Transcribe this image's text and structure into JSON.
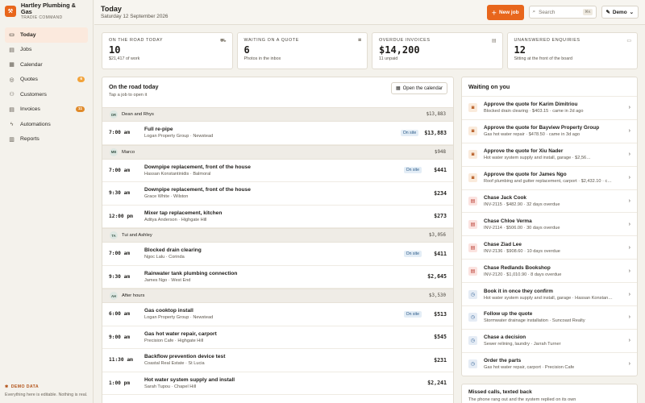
{
  "brand": {
    "logo_icon": "wrench-icon",
    "name": "Hartley Plumbing & Gas",
    "subtitle": "TRADIE COMMAND"
  },
  "nav": [
    {
      "label": "Today",
      "icon": "calendar-today-icon",
      "glyph": "▭",
      "active": true,
      "badge": null
    },
    {
      "label": "Jobs",
      "icon": "clipboard-icon",
      "glyph": "▤",
      "active": false,
      "badge": null
    },
    {
      "label": "Calendar",
      "icon": "calendar-icon",
      "glyph": "▦",
      "active": false,
      "badge": null
    },
    {
      "label": "Quotes",
      "icon": "quote-icon",
      "glyph": "◎",
      "active": false,
      "badge": "6"
    },
    {
      "label": "Customers",
      "icon": "people-icon",
      "glyph": "⚇",
      "active": false,
      "badge": null
    },
    {
      "label": "Invoices",
      "icon": "invoice-icon",
      "glyph": "▤",
      "active": false,
      "badge": "11"
    },
    {
      "label": "Automations",
      "icon": "lightning-icon",
      "glyph": "ϟ",
      "active": false,
      "badge": null
    },
    {
      "label": "Reports",
      "icon": "chart-icon",
      "glyph": "▥",
      "active": false,
      "badge": null
    }
  ],
  "demo": {
    "tag": "DEMO DATA",
    "text": "Everything here is editable. Nothing is real."
  },
  "header": {
    "title": "Today",
    "date": "Saturday 12 September 2026",
    "new_job_label": "New job",
    "search_placeholder": "Search",
    "search_shortcut": "⌘K",
    "demo_select": "Demo"
  },
  "stats": [
    {
      "label": "ON THE ROAD TODAY",
      "value": "10",
      "sub": "$21,417 of work",
      "icon": "truck-icon",
      "glyph": "⛟"
    },
    {
      "label": "WAITING ON A QUOTE",
      "value": "6",
      "sub": "Photos in the inbox",
      "icon": "camera-icon",
      "glyph": "◙"
    },
    {
      "label": "OVERDUE INVOICES",
      "value": "$14,200",
      "sub": "11 unpaid",
      "icon": "invoice-icon",
      "glyph": "▤"
    },
    {
      "label": "UNANSWERED ENQUIRIES",
      "value": "12",
      "sub": "Sitting at the front of the board",
      "icon": "inbox-icon",
      "glyph": "▭"
    }
  ],
  "road": {
    "title": "On the road today",
    "subtitle": "Tap a job to open it",
    "calendar_button": "Open the calendar",
    "onsite_label": "On site",
    "groups": [
      {
        "initials": "DR",
        "name": "Dean and Rhys",
        "total": "$13,883",
        "jobs": [
          {
            "time": "7:00 am",
            "title": "Full re-pipe",
            "meta": "Logan Property Group · Newstead",
            "onsite": true,
            "amount": "$13,883"
          }
        ]
      },
      {
        "initials": "MB",
        "name": "Marco",
        "total": "$948",
        "jobs": [
          {
            "time": "7:00 am",
            "title": "Downpipe replacement, front of the house",
            "meta": "Hassan Konstantinidis · Balmoral",
            "onsite": true,
            "amount": "$441"
          },
          {
            "time": "9:30 am",
            "title": "Downpipe replacement, front of the house",
            "meta": "Grace White · Wilston",
            "onsite": false,
            "amount": "$234"
          },
          {
            "time": "12:00 pm",
            "title": "Mixer tap replacement, kitchen",
            "meta": "Aditya Anderson · Highgate Hill",
            "onsite": false,
            "amount": "$273"
          }
        ]
      },
      {
        "initials": "TA",
        "name": "Tui and Ashley",
        "total": "$3,056",
        "jobs": [
          {
            "time": "7:00 am",
            "title": "Blocked drain clearing",
            "meta": "Ngoc Lalu · Corinda",
            "onsite": true,
            "amount": "$411"
          },
          {
            "time": "9:30 am",
            "title": "Rainwater tank plumbing connection",
            "meta": "James Ngo · West End",
            "onsite": false,
            "amount": "$2,645"
          }
        ]
      },
      {
        "initials": "AH",
        "name": "After hours",
        "total": "$3,530",
        "jobs": [
          {
            "time": "6:00 am",
            "title": "Gas cooktop install",
            "meta": "Logan Property Group · Newstead",
            "onsite": true,
            "amount": "$513"
          },
          {
            "time": "9:00 am",
            "title": "Gas hot water repair, carport",
            "meta": "Precision Cafe · Highgate Hill",
            "onsite": false,
            "amount": "$545"
          },
          {
            "time": "11:30 am",
            "title": "Backflow prevention device test",
            "meta": "Coastal Real Estate · St Lucia",
            "onsite": false,
            "amount": "$231"
          },
          {
            "time": "1:00 pm",
            "title": "Hot water system supply and install",
            "meta": "Sarah Tupou · Chapel Hill",
            "onsite": false,
            "amount": "$2,241"
          }
        ]
      }
    ]
  },
  "waiting": {
    "title": "Waiting on you",
    "items": [
      {
        "kind": "quote",
        "icon": "camera-icon",
        "glyph": "◙",
        "title": "Approve the quote for Karim Dimitriou",
        "meta": "Blocked drain clearing · $403.15 · came in 2d ago"
      },
      {
        "kind": "quote",
        "icon": "camera-icon",
        "glyph": "◙",
        "title": "Approve the quote for Bayview Property Group",
        "meta": "Gas hot water repair · $478.50 · came in 3d ago"
      },
      {
        "kind": "quote",
        "icon": "camera-icon",
        "glyph": "◙",
        "title": "Approve the quote for Xiu Nader",
        "meta": "Hot water system supply and install, garage · $2,56…"
      },
      {
        "kind": "quote",
        "icon": "camera-icon",
        "glyph": "◙",
        "title": "Approve the quote for James Ngo",
        "meta": "Roof plumbing and gutter replacement, carport · $2,432.10 · c…"
      },
      {
        "kind": "invoice",
        "icon": "invoice-icon",
        "glyph": "▤",
        "title": "Chase Jack Cook",
        "meta": "INV-2115 · $482.90 · 32 days overdue"
      },
      {
        "kind": "invoice",
        "icon": "invoice-icon",
        "glyph": "▤",
        "title": "Chase Chloe Verma",
        "meta": "INV-2114 · $506.00 · 30 days overdue"
      },
      {
        "kind": "invoice",
        "icon": "invoice-icon",
        "glyph": "▤",
        "title": "Chase Ziad Lee",
        "meta": "INV-2136 · $908.60 · 10 days overdue"
      },
      {
        "kind": "invoice",
        "icon": "invoice-icon",
        "glyph": "▤",
        "title": "Chase Redlands Bookshop",
        "meta": "INV-2120 · $1,010.90 · 8 days overdue"
      },
      {
        "kind": "followup",
        "icon": "clock-icon",
        "glyph": "◷",
        "title": "Book it in once they confirm",
        "meta": "Hot water system supply and install, garage · Hassan Konstan…"
      },
      {
        "kind": "followup",
        "icon": "clock-icon",
        "glyph": "◷",
        "title": "Follow up the quote",
        "meta": "Stormwater drainage installation · Suncoast Realty"
      },
      {
        "kind": "followup",
        "icon": "clock-icon",
        "glyph": "◷",
        "title": "Chase a decision",
        "meta": "Sewer relining, laundry · Jarrah Turner"
      },
      {
        "kind": "followup",
        "icon": "clock-icon",
        "glyph": "◷",
        "title": "Order the parts",
        "meta": "Gas hot water repair, carport · Precision Cafe"
      }
    ]
  },
  "missed": {
    "title": "Missed calls, texted back",
    "text": "The phone rang out and the system replied on its own"
  }
}
